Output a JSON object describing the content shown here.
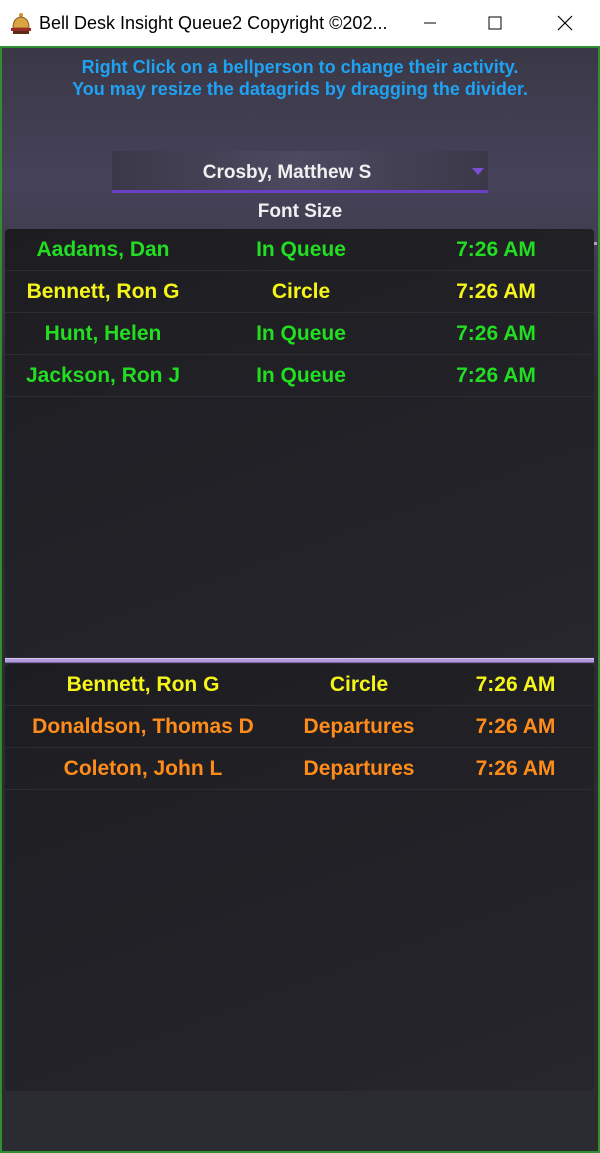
{
  "window": {
    "title": "Bell Desk Insight Queue2 Copyright ©202...",
    "app_icon": "bell-icon",
    "minimize_icon": "minimize-icon",
    "maximize_icon": "maximize-icon",
    "close_icon": "close-icon"
  },
  "instructions": {
    "line1": "Right Click on a bellperson to change their activity.",
    "line2": "You may resize the datagrids by dragging the divider."
  },
  "selector": {
    "value": "Crosby, Matthew S"
  },
  "font_size": {
    "label": "Font Size",
    "slider_fraction": 0.15
  },
  "colors": {
    "in_queue": "#22dd22",
    "circle": "#f5f51a",
    "departures": "#ff8c1a",
    "accent": "#6a3fc4",
    "instructions": "#1fa2f2"
  },
  "queue_grid": {
    "rows": [
      {
        "name": "Aadams, Dan",
        "activity": "In Queue",
        "time": "7:26 AM",
        "color": "#22dd22"
      },
      {
        "name": "Bennett, Ron G",
        "activity": "Circle",
        "time": "7:26 AM",
        "color": "#f5f51a"
      },
      {
        "name": "Hunt, Helen",
        "activity": "In Queue",
        "time": "7:26 AM",
        "color": "#22dd22"
      },
      {
        "name": "Jackson, Ron J",
        "activity": "In Queue",
        "time": "7:26 AM",
        "color": "#22dd22"
      }
    ]
  },
  "activity_grid": {
    "rows": [
      {
        "name": "Bennett, Ron G",
        "activity": "Circle",
        "time": "7:26 AM",
        "color": "#f5f51a"
      },
      {
        "name": "Donaldson, Thomas  D",
        "activity": "Departures",
        "time": "7:26 AM",
        "color": "#ff8c1a"
      },
      {
        "name": "Coleton, John L",
        "activity": "Departures",
        "time": "7:26 AM",
        "color": "#ff8c1a"
      }
    ]
  }
}
